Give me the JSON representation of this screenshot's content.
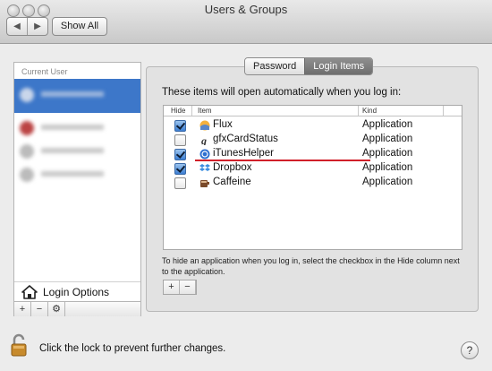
{
  "window": {
    "title": "Users & Groups"
  },
  "toolbar": {
    "back": "◀",
    "forward": "▶",
    "show_all": "Show All"
  },
  "sidebar": {
    "section_label": "Current User",
    "login_options": "Login Options",
    "buttons": [
      "+",
      "−",
      "⚙"
    ]
  },
  "tabs": [
    {
      "label": "Password"
    },
    {
      "label": "Login Items"
    }
  ],
  "login_items": {
    "intro": "These items will open automatically when you log in:",
    "columns": {
      "hide": "Hide",
      "item": "Item",
      "kind": "Kind"
    },
    "rows": [
      {
        "name": "Flux",
        "kind": "Application",
        "hidden": true,
        "icon_color": "#f0a030"
      },
      {
        "name": "gfxCardStatus",
        "kind": "Application",
        "hidden": false,
        "icon_color": "#333333"
      },
      {
        "name": "iTunesHelper",
        "kind": "Application",
        "hidden": true,
        "icon_color": "#2d6fd0"
      },
      {
        "name": "Dropbox",
        "kind": "Application",
        "hidden": true,
        "icon_color": "#3d8ee0"
      },
      {
        "name": "Caffeine",
        "kind": "Application",
        "hidden": false,
        "icon_color": "#7a4a2a"
      }
    ],
    "hint": "To hide an application when you log in, select the checkbox in the Hide column next to the application.",
    "buttons": [
      "+",
      "−"
    ]
  },
  "footer": {
    "lock_text": "Click the lock to prevent further changes.",
    "help": "?"
  },
  "colors": {
    "selection": "#3d77c9",
    "annotation": "#d1202a"
  }
}
